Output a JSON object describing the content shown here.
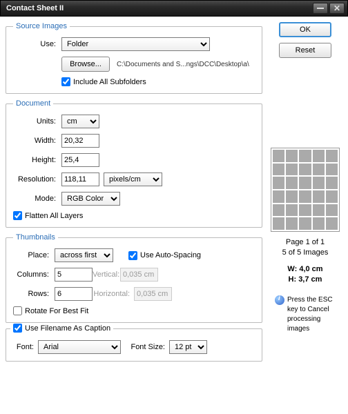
{
  "window": {
    "title": "Contact Sheet II"
  },
  "buttons": {
    "ok": "OK",
    "reset": "Reset",
    "browse": "Browse..."
  },
  "source": {
    "legend": "Source Images",
    "use_label": "Use:",
    "use_value": "Folder",
    "path": "C:\\Documents and S...ngs\\DCC\\Desktop\\a\\",
    "include_label": "Include All Subfolders",
    "include_checked": true
  },
  "document": {
    "legend": "Document",
    "units_label": "Units:",
    "units_value": "cm",
    "width_label": "Width:",
    "width_value": "20,32",
    "height_label": "Height:",
    "height_value": "25,4",
    "res_label": "Resolution:",
    "res_value": "118,11",
    "res_units": "pixels/cm",
    "mode_label": "Mode:",
    "mode_value": "RGB Color",
    "flatten_label": "Flatten All Layers",
    "flatten_checked": true
  },
  "thumbnails": {
    "legend": "Thumbnails",
    "place_label": "Place:",
    "place_value": "across first",
    "autospace_label": "Use Auto-Spacing",
    "autospace_checked": true,
    "columns_label": "Columns:",
    "columns_value": "5",
    "rows_label": "Rows:",
    "rows_value": "6",
    "vertical_label": "Vertical:",
    "vertical_value": "0,035 cm",
    "horizontal_label": "Horizontal:",
    "horizontal_value": "0,035 cm",
    "rotate_label": "Rotate For Best Fit",
    "rotate_checked": false
  },
  "caption": {
    "legend": "Use Filename As Caption",
    "checked": true,
    "font_label": "Font:",
    "font_value": "Arial",
    "size_label": "Font Size:",
    "size_value": "12 pt"
  },
  "preview": {
    "page": "Page 1 of 1",
    "count": "5 of 5 Images",
    "w": "W: 4,0 cm",
    "h": "H: 3,7 cm",
    "esc": "Press the ESC key to Cancel processing images"
  }
}
